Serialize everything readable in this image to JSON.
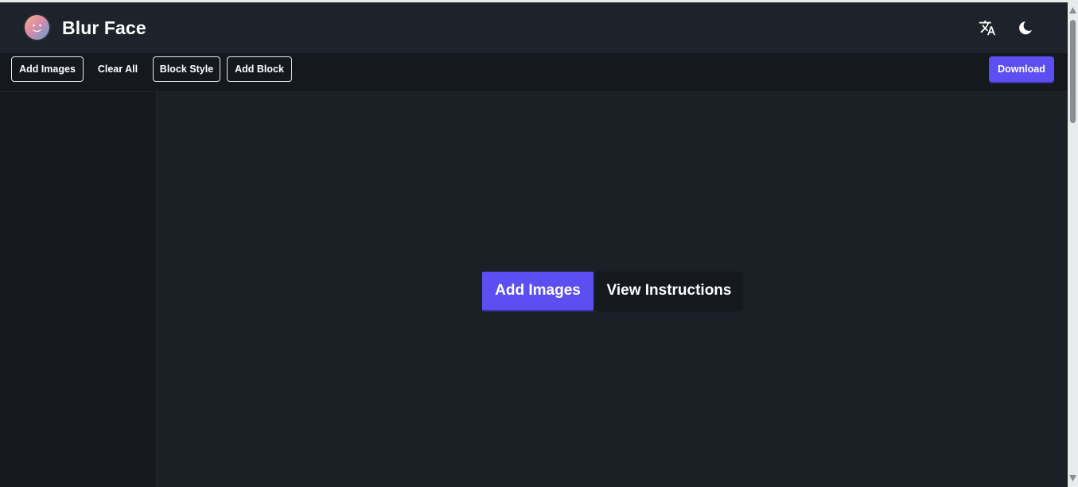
{
  "header": {
    "title": "Blur Face",
    "icons": {
      "logo": "smiley-logo-icon",
      "translate": "translate-icon",
      "theme": "moon-icon"
    }
  },
  "toolbar": {
    "add_images": "Add Images",
    "clear_all": "Clear All",
    "block_style": "Block Style",
    "add_block": "Add Block",
    "download": "Download"
  },
  "main": {
    "add_images": "Add Images",
    "view_instructions": "View Instructions"
  },
  "colors": {
    "accent": "#5b4ff2",
    "background": "#1b1f26",
    "header": "#1e232b",
    "panel": "#15181d"
  }
}
